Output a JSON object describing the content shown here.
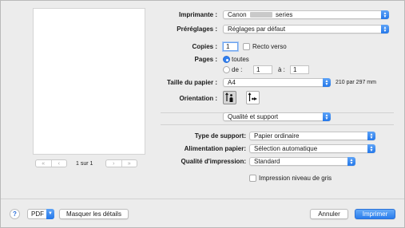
{
  "preview": {
    "page_indicator": "1 sur 1",
    "nav_first": "«",
    "nav_prev": "‹",
    "nav_next": "›",
    "nav_last": "»"
  },
  "printer": {
    "label": "Imprimante :",
    "value_prefix": "Canon",
    "value_suffix": "series"
  },
  "presets": {
    "label": "Préréglages :",
    "value": "Réglages par défaut"
  },
  "copies": {
    "label": "Copies :",
    "value": "1",
    "duplex_label": "Recto verso"
  },
  "pages": {
    "label": "Pages :",
    "all_label": "toutes",
    "from_label": "de :",
    "from_value": "1",
    "to_label": "à :",
    "to_value": "1"
  },
  "paper_size": {
    "label": "Taille du papier :",
    "value": "A4",
    "dimensions": "210 par 297 mm"
  },
  "orientation": {
    "label": "Orientation :"
  },
  "section": {
    "value": "Qualité et support"
  },
  "media_type": {
    "label": "Type de support:",
    "value": "Papier ordinaire"
  },
  "paper_source": {
    "label": "Alimentation papier:",
    "value": "Sélection automatique"
  },
  "print_quality": {
    "label": "Qualité d'impression:",
    "value": "Standard"
  },
  "grayscale": {
    "label": "Impression niveau de gris"
  },
  "footer": {
    "help": "?",
    "pdf": "PDF",
    "hide_details": "Masquer les détails",
    "cancel": "Annuler",
    "print": "Imprimer"
  },
  "colors": {
    "accent": "#2a7ded",
    "background": "#ececec"
  }
}
